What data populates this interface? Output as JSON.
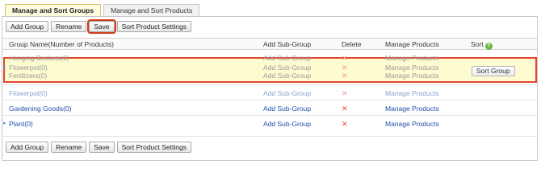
{
  "tabs": [
    {
      "label": "Manage and Sort Groups"
    },
    {
      "label": "Manage and Sort Products"
    }
  ],
  "toolbar": {
    "add_group": "Add Group",
    "rename": "Rename",
    "save": "Save",
    "sort_settings": "Sort Product Settings"
  },
  "table": {
    "headers": {
      "name": "Group Name(Number of Products)",
      "sub": "Add Sub-Group",
      "delete": "Delete",
      "manage": "Manage Products",
      "sort": "Sort"
    },
    "rows": [
      {
        "name": "Hanging Baskets(0)",
        "sub": "Add Sub-Group",
        "delete": "✕",
        "manage": "Manage Products"
      },
      {
        "name": "Flowerpot(0)",
        "sub": "Add Sub-Group",
        "delete": "✕",
        "manage": "Manage Products"
      },
      {
        "name": "Fertilizers(0)",
        "sub": "Add Sub-Group",
        "delete": "✕",
        "manage": "Manage Products"
      },
      {
        "name": "Flowerpot(0)",
        "sub": "Add Sub-Group",
        "delete": "✕",
        "manage": "Manage Products"
      },
      {
        "name": "Gardening Goods(0)",
        "sub": "Add Sub-Group",
        "delete": "✕",
        "manage": "Manage Products"
      },
      {
        "name": "Plant(0)",
        "sub": "Add Sub-Group",
        "delete": "✕",
        "manage": "Manage Products"
      }
    ],
    "sort_button": "Sort Group"
  },
  "icons": {
    "help": "help-icon",
    "delete": "delete-x-icon",
    "expand": "expand-arrow-icon"
  },
  "colors": {
    "highlight_border": "#e5452e",
    "drag_background": "#fdfbd0",
    "link": "#1f4fa8",
    "delete": "#e34b3b"
  }
}
